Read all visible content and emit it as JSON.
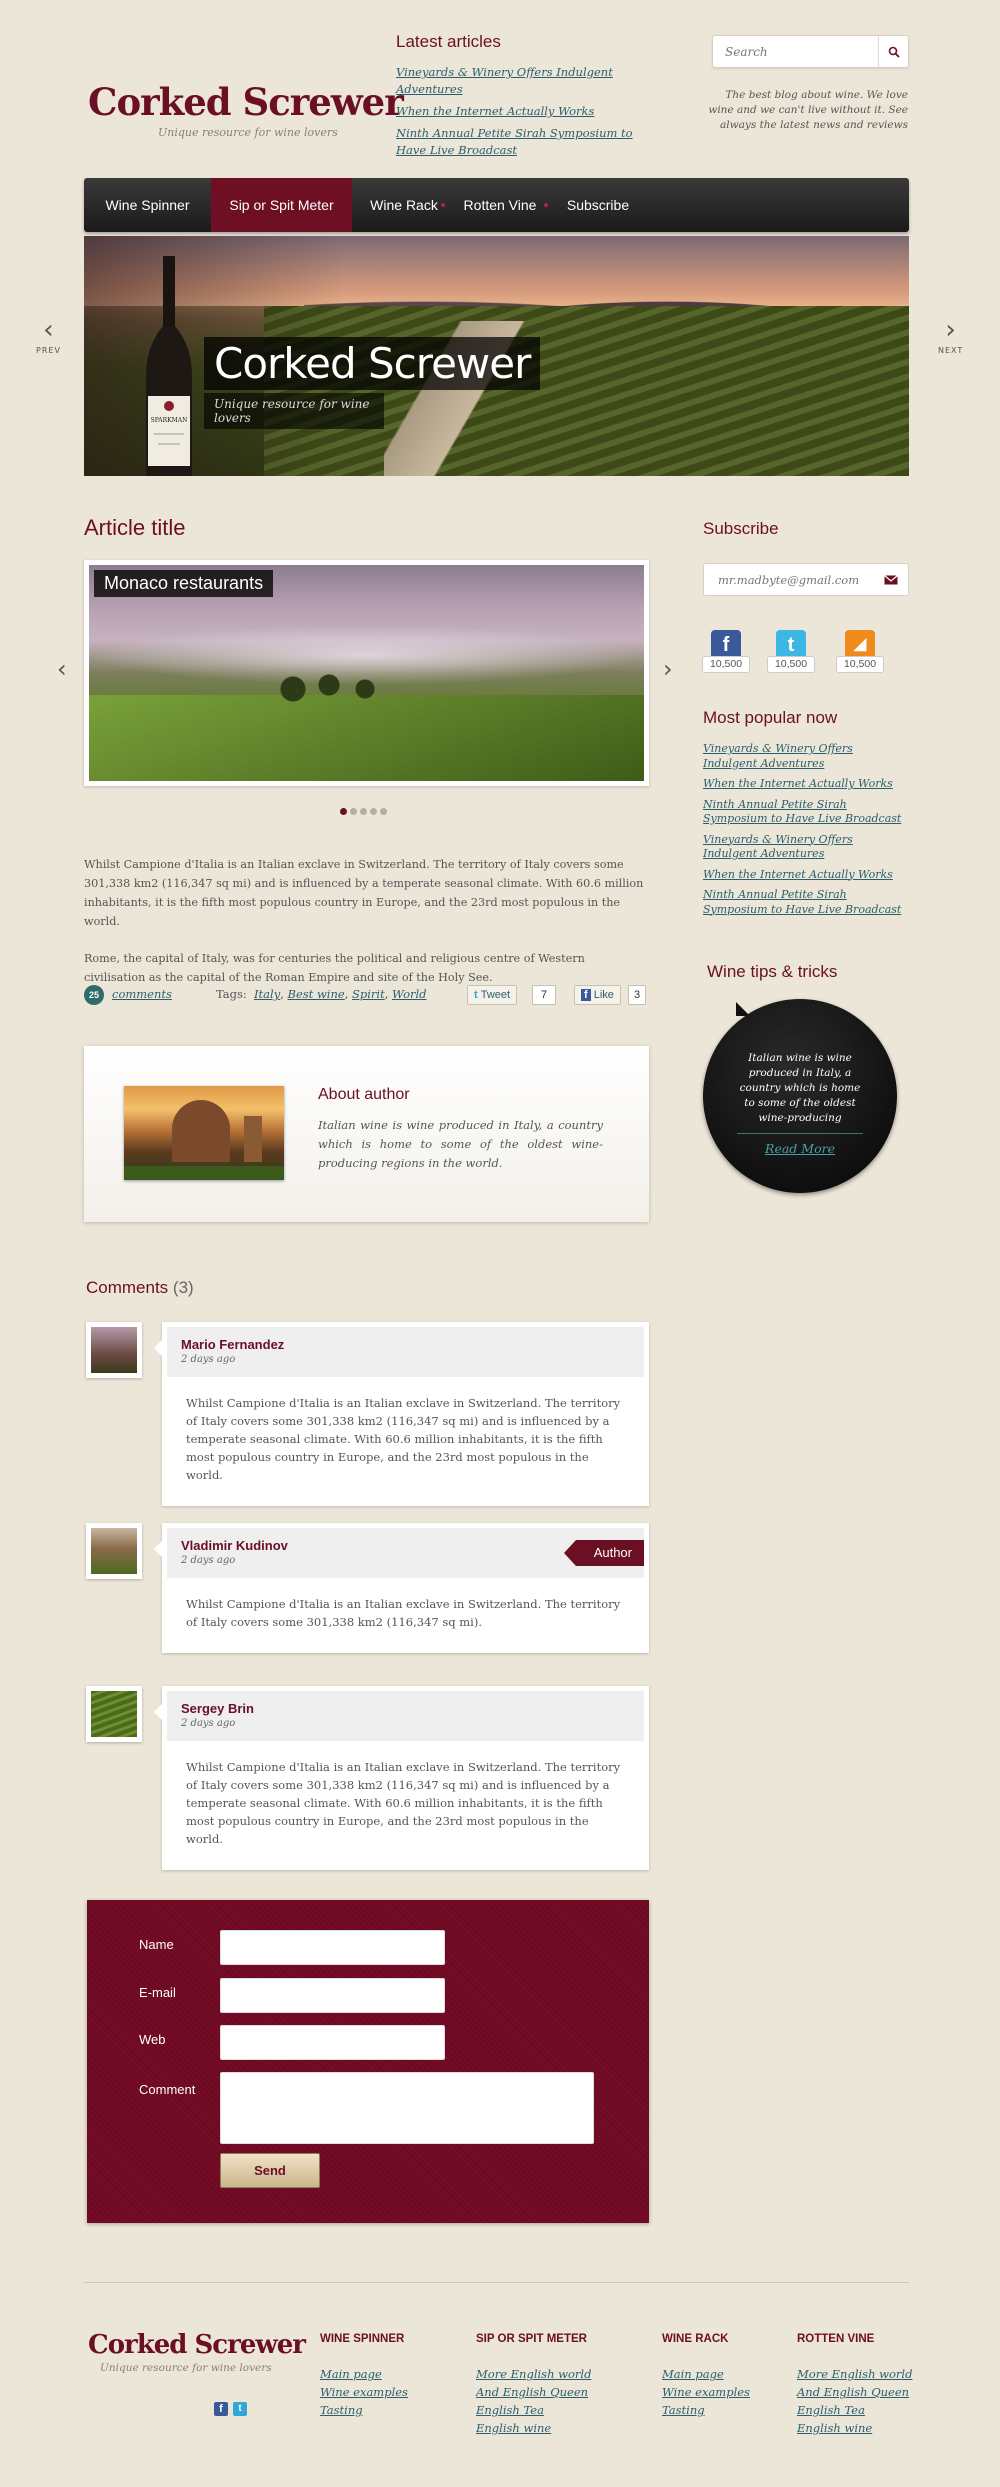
{
  "header": {
    "latest_title": "Latest articles",
    "latest_articles": [
      "Vineyards & Winery Offers Indulgent Adventures",
      "When the Internet Actually Works",
      "Ninth Annual Petite Sirah Symposium to Have Live Broadcast"
    ],
    "search_placeholder": "Search",
    "tagline": "The best blog about wine. We love wine and we can't live without it. See always the latest news and reviews",
    "brand": "Corked Screwer",
    "brand_sub": "Unique resource for wine lovers"
  },
  "nav": {
    "items": [
      "Wine Spinner",
      "Sip or Spit Meter",
      "Wine Rack",
      "Rotten Vine",
      "Subscribe"
    ],
    "active": "Sip or Spit Meter"
  },
  "hero": {
    "title": "Corked Screwer",
    "subtitle": "Unique resource for wine lovers",
    "bottle_label": "SPARKMAN",
    "prev": "PREV",
    "next": "NEXT"
  },
  "article": {
    "title": "Article title",
    "gallery_caption": "Monaco restaurants",
    "gallery_slides": 5,
    "gallery_active": 1,
    "paragraphs": [
      "Whilst Campione d'Italia is an Italian exclave in Switzerland. The territory of Italy covers some 301,338 km2 (116,347 sq mi) and is influenced by a temperate seasonal climate. With 60.6 million inhabitants, it is the fifth most populous country in Europe, and the 23rd most populous in the world.",
      "Rome, the capital of Italy, was for centuries the political and religious centre of Western civilisation as the capital of the Roman Empire and site of the Holy See."
    ],
    "comment_count": "25",
    "comments_link": "comments",
    "tags_label": "Tags:",
    "tags": [
      "Italy",
      "Best wine",
      "Spirit",
      "World"
    ],
    "tweet_label": "Tweet",
    "tweet_count": "7",
    "like_label": "Like",
    "like_count": "3"
  },
  "author": {
    "title": "About author",
    "text": "Italian wine is wine produced in Italy, a country which is home to some of the oldest wine-producing regions in the world."
  },
  "comments": {
    "title": "Comments",
    "count": "(3)",
    "items": [
      {
        "name": "Mario Fernandez",
        "date": "2 days ago",
        "text": "Whilst Campione d'Italia is an Italian exclave in Switzerland. The territory of Italy covers some 301,338 km2 (116,347 sq mi) and is influenced by a temperate seasonal climate. With 60.6 million inhabitants, it is the fifth most populous country in Europe, and the 23rd most populous in the world.",
        "is_author": false
      },
      {
        "name": "Vladimir Kudinov",
        "date": "2 days ago",
        "text": "Whilst Campione d'Italia is an Italian exclave in Switzerland. The territory of Italy covers some 301,338 km2 (116,347 sq mi).",
        "is_author": true,
        "badge": "Author"
      },
      {
        "name": "Sergey Brin",
        "date": "2 days ago",
        "text": "Whilst Campione d'Italia is an Italian exclave in Switzerland. The territory of Italy covers some 301,338 km2 (116,347 sq mi) and is influenced by a temperate seasonal climate. With 60.6 million inhabitants, it is the fifth most populous country in Europe, and the 23rd most populous in the world.",
        "is_author": false
      }
    ]
  },
  "form": {
    "name_label": "Name",
    "email_label": "E-mail",
    "web_label": "Web",
    "comment_label": "Comment",
    "send_label": "Send"
  },
  "sidebar": {
    "subscribe_title": "Subscribe",
    "subscribe_placeholder": "mr.madbyte@gmail.com",
    "social": [
      {
        "icon": "facebook-icon",
        "glyph": "f",
        "count": "10,500",
        "color": "#3b5998"
      },
      {
        "icon": "twitter-icon",
        "glyph": "t",
        "count": "10,500",
        "color": "#3cb6e3"
      },
      {
        "icon": "rss-icon",
        "glyph": "◢",
        "count": "10,500",
        "color": "#f08a1c"
      }
    ],
    "popular_title": "Most popular now",
    "popular": [
      "Vineyards & Winery Offers Indulgent Adventures",
      "When the Internet Actually Works",
      "Ninth Annual Petite Sirah Symposium to Have Live Broadcast",
      "Vineyards & Winery Offers Indulgent Adventures",
      "When the Internet Actually Works",
      "Ninth Annual Petite Sirah Symposium to Have Live Broadcast"
    ],
    "tips_title": "Wine tips & tricks",
    "tips_text": "Italian wine is wine produced in Italy, a country which is home to some of the oldest wine-producing",
    "tips_more": "Read More"
  },
  "footer": {
    "brand": "Corked Screwer",
    "brand_sub": "Unique resource for wine lovers",
    "columns": [
      {
        "title": "WINE SPINNER",
        "items": [
          "Main page",
          "Wine examples",
          "Tasting"
        ]
      },
      {
        "title": "SIP OR SPIT METER",
        "items": [
          "More English world",
          "And English Queen",
          "English Tea",
          "English wine"
        ]
      },
      {
        "title": "WINE RACK",
        "items": [
          "Main page",
          "Wine examples",
          "Tasting"
        ]
      },
      {
        "title": "ROTTEN VINE",
        "items": [
          "More English world",
          "And English Queen",
          "English Tea",
          "English wine"
        ]
      }
    ]
  },
  "colors": {
    "brand": "#6b0f24",
    "link": "#2a5f6e",
    "background": "#ece6d8"
  }
}
